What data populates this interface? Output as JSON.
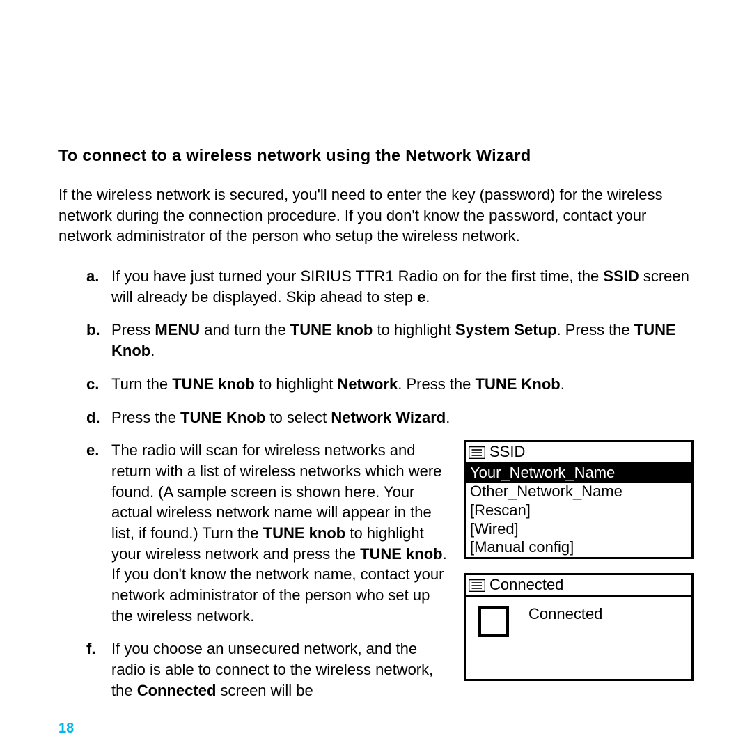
{
  "heading": "To connect to a wireless network using the Network Wizard",
  "intro": "If the wireless network is secured, you'll need to enter the key (password) for the wireless network during the connection procedure. If you don't know the password, contact your network administrator of the person who setup the wireless network.",
  "steps": {
    "a": {
      "marker": "a.",
      "pre": "If you have just turned your SIRIUS TTR1 Radio on for the first time, the ",
      "b1": "SSID",
      "mid1": " screen will already be displayed. Skip ahead to step ",
      "b2": "e",
      "post": "."
    },
    "b": {
      "marker": "b.",
      "t1": "Press ",
      "b1": "MENU",
      "t2": " and turn the ",
      "b2": "TUNE knob",
      "t3": " to highlight ",
      "b3": "System Setup",
      "t4": ". Press the ",
      "b4": "TUNE Knob",
      "t5": "."
    },
    "c": {
      "marker": "c.",
      "t1": "Turn the ",
      "b1": "TUNE knob",
      "t2": " to highlight ",
      "b2": "Network",
      "t3": ". Press the ",
      "b3": "TUNE Knob",
      "t4": "."
    },
    "d": {
      "marker": "d.",
      "t1": "Press the ",
      "b1": "TUNE Knob",
      "t2": " to select ",
      "b2": "Network Wizard",
      "t3": "."
    },
    "e": {
      "marker": "e.",
      "t1": "The radio will scan for wireless networks and return with a list of wireless networks which were found. (A sample screen is shown here. Your actual wireless network name will appear in the list, if found.) Turn the ",
      "b1": "TUNE knob",
      "t2": " to highlight your wireless network and press the ",
      "b2": "TUNE knob",
      "t3": ". If you don't know the network name, contact your network administrator of the person who set up the wireless network."
    },
    "f": {
      "marker": "f.",
      "t1": "If you choose an unsecured network, and the radio is able to connect to the wireless network, the ",
      "b1": "Connected",
      "t2": " screen will be"
    }
  },
  "ssid_screen": {
    "title": "SSID",
    "items": [
      "Your_Network_Name",
      "Other_Network_Name",
      "[Rescan]",
      "[Wired]",
      "[Manual config]"
    ],
    "selected_index": 0
  },
  "connected_screen": {
    "title": "Connected",
    "body": "Connected"
  },
  "page_number": "18"
}
